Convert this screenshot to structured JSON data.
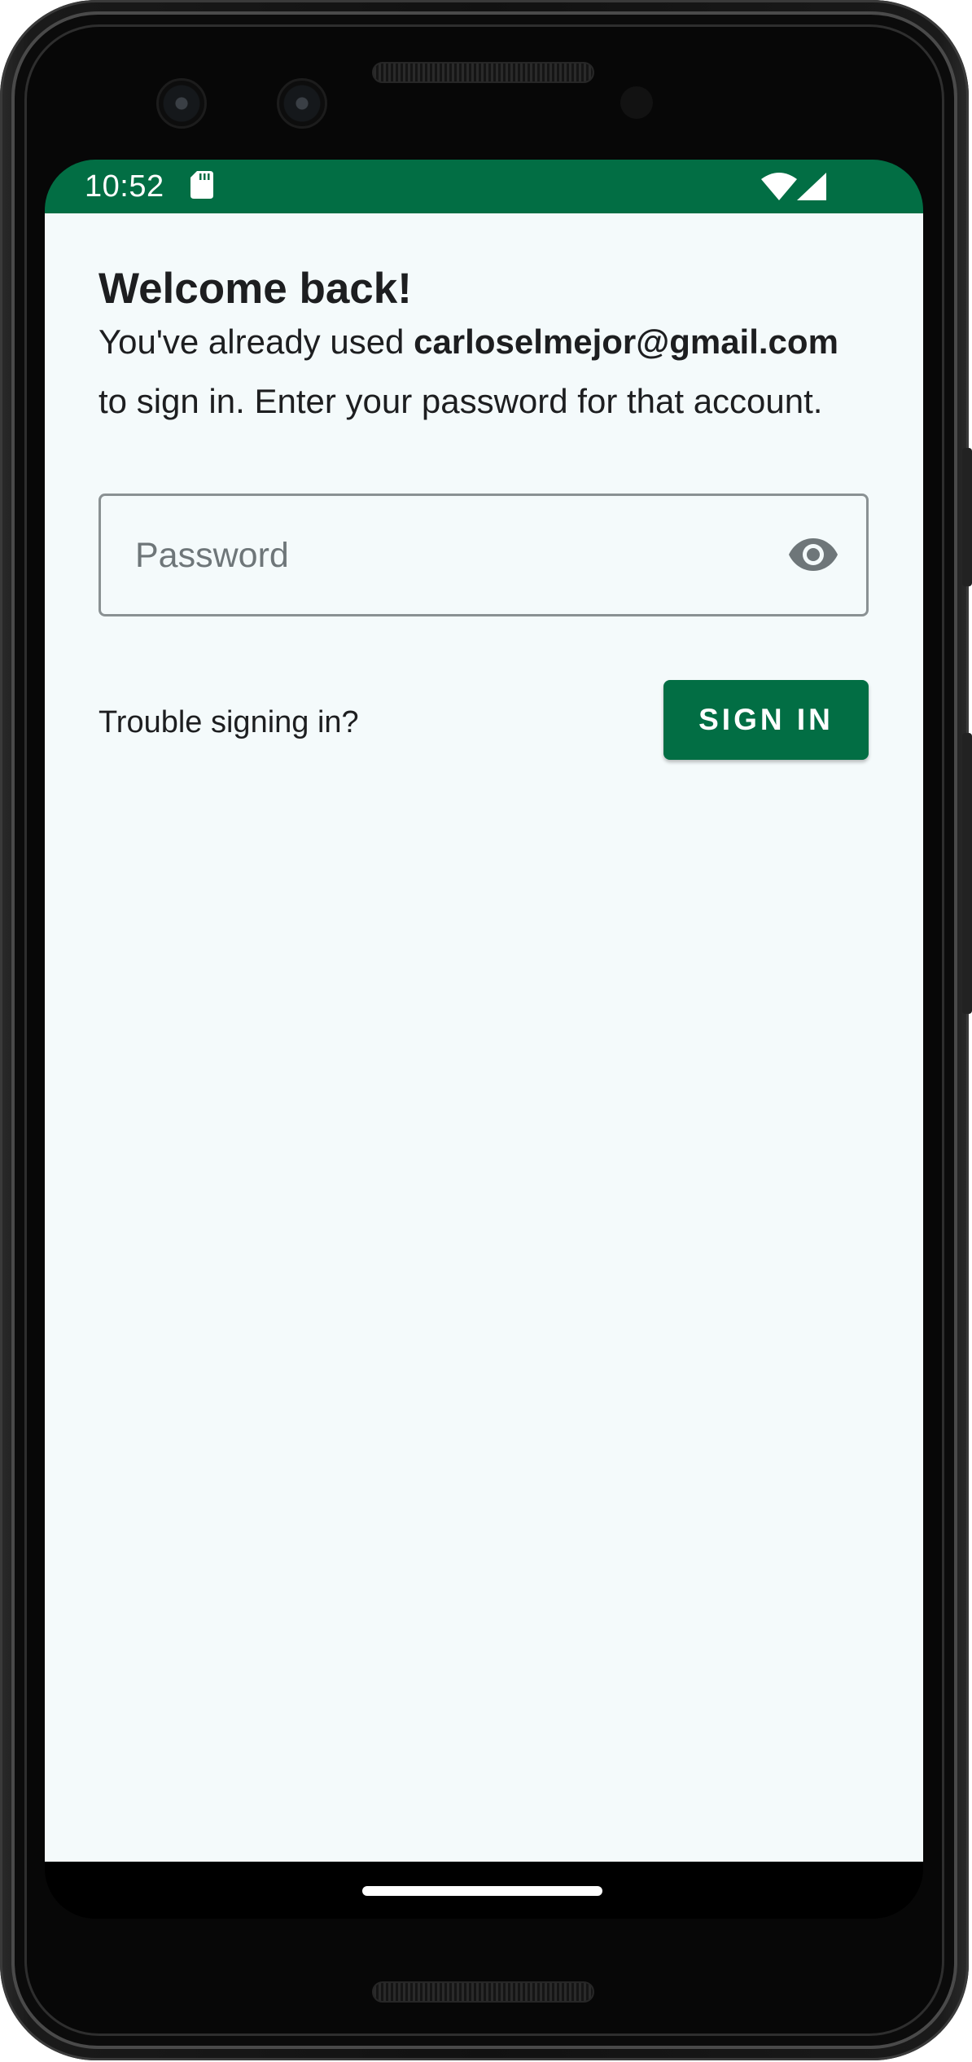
{
  "status_bar": {
    "time": "10:52",
    "background_color": "#026e44",
    "icons": [
      "sd-card-icon",
      "wifi-icon",
      "cell-signal-icon"
    ]
  },
  "sign_in": {
    "title": "Welcome back!",
    "message_prefix": "You've already used ",
    "email": "carloselmejor@gmail.com",
    "message_suffix": "to sign in. Enter your password for that account.",
    "password_placeholder": "Password",
    "password_value": "",
    "visibility_toggle_icon": "eye-icon",
    "trouble_link": "Trouble signing in?",
    "submit_label": "SIGN IN",
    "accent_color": "#026e44",
    "background_color": "#f4fafb"
  }
}
